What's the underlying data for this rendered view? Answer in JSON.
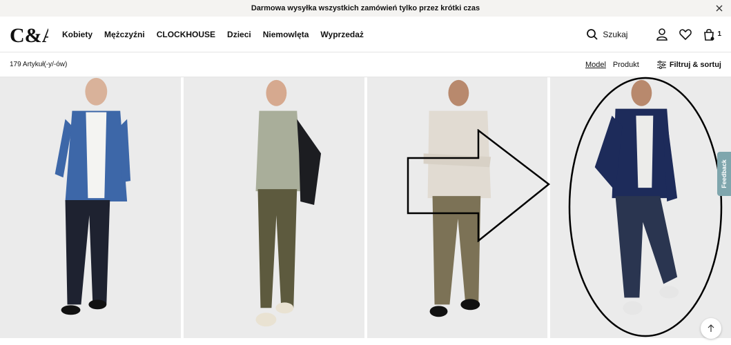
{
  "promo": {
    "text": "Darmowa wysyłka wszystkich zamówień tylko przez krótki czas"
  },
  "header": {
    "logo": "C&A",
    "nav": [
      "Kobiety",
      "Mężczyźni",
      "CLOCKHOUSE",
      "Dzieci",
      "Niemowlęta",
      "Wyprzedaż"
    ],
    "search_label": "Szukaj",
    "cart_count": "1"
  },
  "toolbar": {
    "count": "179 Artykuł(-y/-ów)",
    "view_model": "Model",
    "view_product": "Produkt",
    "filter_label": "Filtruj & sortuj"
  },
  "feedback": "Feedback",
  "colors": {
    "accent": "#111111",
    "feedback_tab": "#7fa6ad",
    "card_bg": "#ebebeb"
  }
}
